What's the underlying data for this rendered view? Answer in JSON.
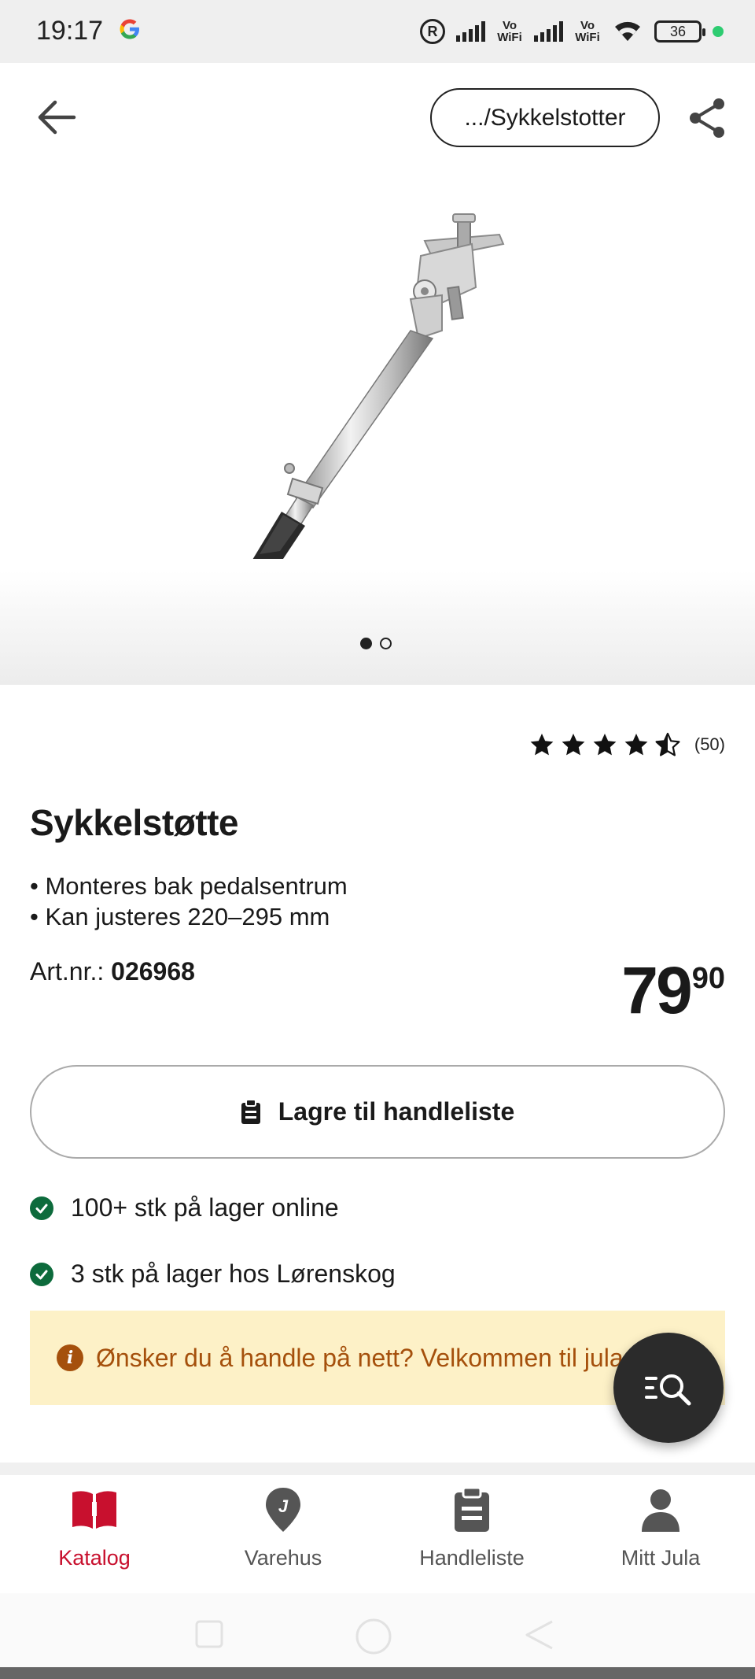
{
  "status_bar": {
    "time": "19:17",
    "battery": "36",
    "vowifi_1": "Vo WiFi",
    "vowifi_2": "Vo WiFi"
  },
  "header": {
    "breadcrumb": ".../Sykkelstotter"
  },
  "gallery": {
    "image_count": 2,
    "active_index": 0
  },
  "product": {
    "rating_value": 4.5,
    "rating_count": "(50)",
    "title": "Sykkelstøtte",
    "bullet_1": "• Monteres bak pedalsentrum",
    "bullet_2": "• Kan justeres 220–295 mm",
    "artnr_label": "Art.nr.:",
    "artnr_value": "026968",
    "price_main": "79",
    "price_decimals": "90"
  },
  "actions": {
    "save_label": "Lagre til handleliste"
  },
  "stock": {
    "online": "100+ stk på lager online",
    "store": "3 stk på lager hos Lørenskog"
  },
  "notice": {
    "text": "Ønsker du å handle på nett? Velkommen til jula.no"
  },
  "bottom_nav": {
    "items": [
      {
        "label": "Katalog",
        "icon": "book-icon",
        "active": true
      },
      {
        "label": "Varehus",
        "icon": "location-pin-icon",
        "active": false
      },
      {
        "label": "Handleliste",
        "icon": "clipboard-icon",
        "active": false
      },
      {
        "label": "Mitt Jula",
        "icon": "user-icon",
        "active": false
      }
    ]
  },
  "colors": {
    "accent_red": "#c8102e",
    "stock_green": "#0d6b3c",
    "notice_bg": "#fdf1c7",
    "notice_text": "#a5500c"
  }
}
